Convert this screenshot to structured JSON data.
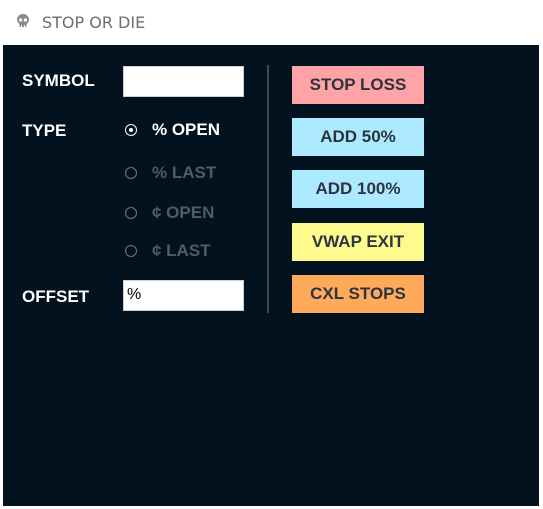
{
  "window": {
    "title": "STOP OR DIE",
    "icon": "skull-icon"
  },
  "form": {
    "symbol_label": "SYMBOL",
    "symbol_value": "",
    "type_label": "TYPE",
    "type_options": [
      {
        "label": "% OPEN",
        "selected": true
      },
      {
        "label": "% LAST",
        "selected": false
      },
      {
        "label": "¢ OPEN",
        "selected": false
      },
      {
        "label": "¢ LAST",
        "selected": false
      }
    ],
    "offset_label": "OFFSET",
    "offset_value": "%"
  },
  "buttons": [
    {
      "label": "STOP LOSS",
      "color": "#ffa3a6"
    },
    {
      "label": "ADD 50%",
      "color": "#aeeaff"
    },
    {
      "label": "ADD 100%",
      "color": "#aeeaff"
    },
    {
      "label": "VWAP EXIT",
      "color": "#fffa8e"
    },
    {
      "label": "CXL STOPS",
      "color": "#ffa95a"
    }
  ],
  "colors": {
    "background": "#02121f",
    "text": "#ffffff",
    "disabled_text": "#4d5c69"
  }
}
